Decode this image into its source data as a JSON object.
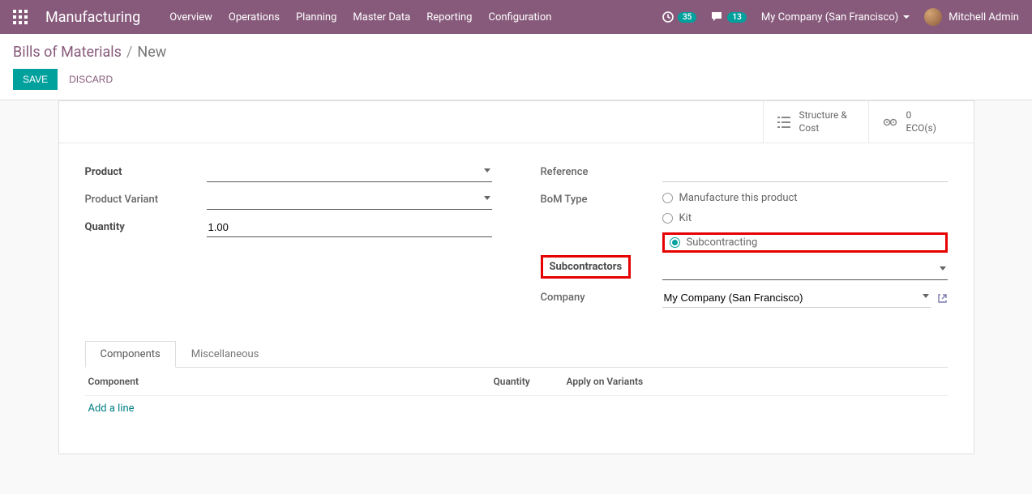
{
  "topbar": {
    "app_title": "Manufacturing",
    "menu": [
      "Overview",
      "Operations",
      "Planning",
      "Master Data",
      "Reporting",
      "Configuration"
    ],
    "activity_badge": "35",
    "discuss_badge": "13",
    "company": "My Company (San Francisco)",
    "user": "Mitchell Admin"
  },
  "breadcrumb": {
    "link": "Bills of Materials",
    "current": "New"
  },
  "actions": {
    "save": "SAVE",
    "discard": "DISCARD"
  },
  "stat_buttons": {
    "structure_l1": "Structure &",
    "structure_l2": "Cost",
    "ecos_l1": "0",
    "ecos_l2": "ECO(s)"
  },
  "form": {
    "product_label": "Product",
    "variant_label": "Product Variant",
    "quantity_label": "Quantity",
    "quantity_value": "1.00",
    "reference_label": "Reference",
    "bom_type_label": "BoM Type",
    "bom_type_options": {
      "manufacture": "Manufacture this product",
      "kit": "Kit",
      "subcontracting": "Subcontracting"
    },
    "subcontractors_label": "Subcontractors",
    "company_label": "Company",
    "company_value": "My Company (San Francisco)"
  },
  "tabs": {
    "components": "Components",
    "misc": "Miscellaneous"
  },
  "table": {
    "col_component": "Component",
    "col_quantity": "Quantity",
    "col_variants": "Apply on Variants",
    "add_line": "Add a line"
  }
}
